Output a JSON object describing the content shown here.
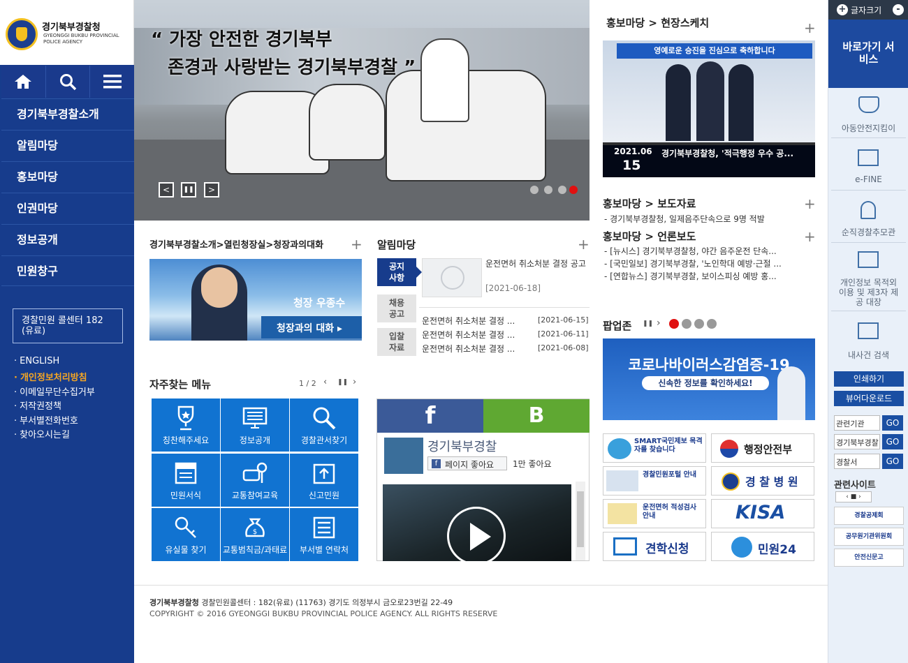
{
  "logo": {
    "title": "경기북부경찰청",
    "subtitle": "GYEONGGI BUKBU PROVINCIAL POLICE AGENCY"
  },
  "gnb": [
    "경기북부경찰소개",
    "알림마당",
    "홍보마당",
    "인권마당",
    "정보공개",
    "민원창구"
  ],
  "callcenter": "경찰민원 콜센터 182 (유료)",
  "quicklinks": [
    "ENGLISH",
    "개인정보처리방침",
    "이메일무단수집거부",
    "저작권정책",
    "부서별전화번호",
    "찾아오시는길"
  ],
  "hero": {
    "line1": "“ 가장 안전한 경기북부",
    "line2": "존경과 사랑받는 경기북부경찰 ”"
  },
  "sketch": {
    "title": "홍보마당 > 현장스케치",
    "banner": "영예로운 승진을 진심으로 축하합니다",
    "date_ym": "2021.06",
    "date_d": "15",
    "caption": "경기북부경찰청, '적극행정 우수 공..."
  },
  "press": {
    "title": "홍보마당 > 보도자료",
    "item": "- 경기북부경찰청, 일제음주단속으로 9명 적발"
  },
  "media": {
    "title": "홍보마당 > 언론보도",
    "items": [
      "- [뉴시스] 경기북부경찰청, 야간 음주운전 단속...",
      "- [국민일보] 경기북부경찰, '노인학대 예방·근절 ...",
      "- [연합뉴스] 경기북부경찰, 보이스피싱 예방 홍..."
    ]
  },
  "chief": {
    "title": "경기북부경찰소개>열린청장실>청장과의대화",
    "name": "청장 우종수",
    "link": "청장과의 대화 ▸"
  },
  "notice": {
    "title": "알림마당",
    "tabs": [
      "공지\n사항",
      "채용\n공고",
      "입찰\n자료"
    ],
    "featured_text": "운전면허 취소처분 결정 공고",
    "featured_date": "[2021-06-18]",
    "rows": [
      {
        "text": "운전면허 취소처분 결정 ...",
        "date": "[2021-06-15]"
      },
      {
        "text": "운전면허 취소처분 결정 ...",
        "date": "[2021-06-11]"
      },
      {
        "text": "운전면허 취소처분 결정 ...",
        "date": "[2021-06-08]"
      }
    ]
  },
  "freq": {
    "title": "자주찾는 메뉴",
    "page": "1 / 2",
    "tiles": [
      "칭찬해주세요",
      "정보공개",
      "경찰관서찾기",
      "민원서식",
      "교통참여교육",
      "신고민원",
      "유실물 찾기",
      "교통범칙금/과태료",
      "부서별 연락처"
    ]
  },
  "sns": {
    "name": "경기북부경찰",
    "like": "페이지 좋아요",
    "count": "1만 좋아요",
    "fb": "f",
    "blog": "B"
  },
  "popup": {
    "title": "팝업존",
    "banner_title": "코로나바이러스감염증-19",
    "banner_sub": "신속한 정보를 확인하세요!"
  },
  "partners": [
    "SMART국민제보 목격자를 찾습니다",
    "행정안전부",
    "경찰민원포털 안내",
    "경 찰 병 원",
    "운전면허 적성검사 안내",
    "KISA",
    "견학신청",
    "민원24"
  ],
  "side": {
    "font_label": "글자크기",
    "shortcut": "바로가기 서비스",
    "items": [
      "아동안전지킴이",
      "e-FINE",
      "순직경찰추모관",
      "개인정보 목적외 이용 및 제3자 제공 대장",
      "내사건 검색"
    ],
    "print": "인쇄하기",
    "viewer": "뷰어다운로드",
    "selects": [
      "관련기관",
      "경기북부경찰",
      "경찰서"
    ],
    "go": "GO",
    "related": "관련사이트",
    "banners": [
      "경찰공제회",
      "공무원기관위원회",
      "안전신문고"
    ]
  },
  "footer": {
    "org": "경기북부경찰청",
    "line1": "경찰민원콜센터 : 182(유료) (11763) 경기도 의정부시 금오로23번길 22-49",
    "copyright": "COPYRIGHT © 2016 GYEONGGI BUKBU PROVINCIAL POLICE AGENCY. ALL RIGHTS RESERVE"
  },
  "colors": {
    "navy": "#173c8c",
    "tile": "#1173d1",
    "accent": "#f5a623",
    "red": "#e01010"
  }
}
